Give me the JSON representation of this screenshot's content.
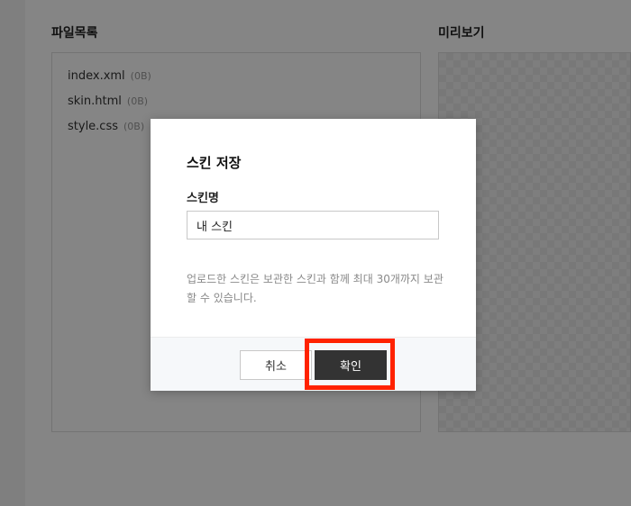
{
  "files": {
    "title": "파일목록",
    "items": [
      {
        "name": "index.xml",
        "size": "(0B)"
      },
      {
        "name": "skin.html",
        "size": "(0B)"
      },
      {
        "name": "style.css",
        "size": "(0B)"
      }
    ]
  },
  "preview": {
    "title": "미리보기"
  },
  "modal": {
    "title": "스킨 저장",
    "field_label": "스킨명",
    "input_value": "내 스킨",
    "help_text": "업로드한 스킨은 보관한 스킨과 함께 최대 30개까지 보관할 수 있습니다.",
    "cancel_label": "취소",
    "confirm_label": "확인"
  },
  "colors": {
    "highlight": "#ff2200",
    "confirm_bg": "#333333"
  }
}
